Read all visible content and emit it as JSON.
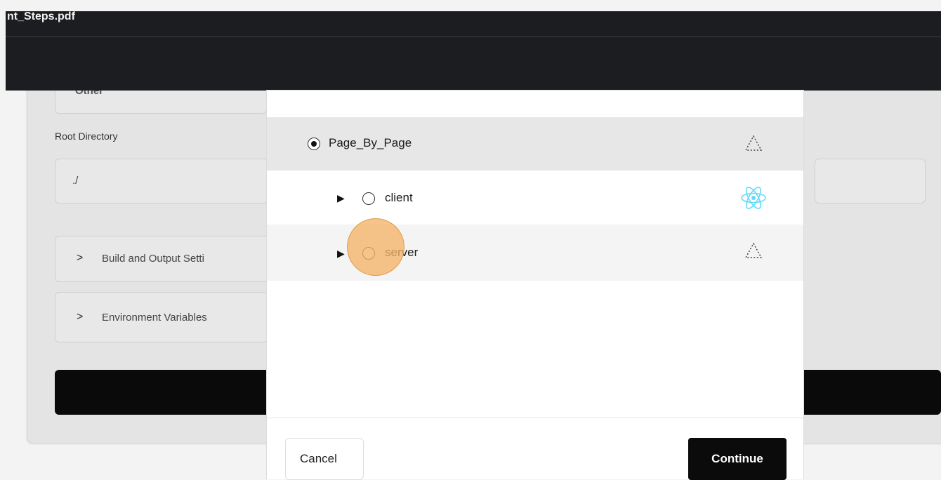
{
  "header": {
    "filename": "nt_Steps.pdf"
  },
  "background_form": {
    "framework_value": "Other",
    "root_directory_label": "Root Directory",
    "root_directory_value": "./",
    "build_section_label": "Build and Output Setti",
    "env_section_label": "Environment Variables"
  },
  "modal": {
    "rows": [
      {
        "label": "Page_By_Page",
        "selected": true,
        "framework_icon": "vercel-triangle-icon"
      },
      {
        "label": "client",
        "selected": false,
        "framework_icon": "react-icon"
      },
      {
        "label": "server",
        "selected": false,
        "framework_icon": "vercel-triangle-icon"
      }
    ],
    "cancel_label": "Cancel",
    "continue_label": "Continue"
  },
  "colors": {
    "accent": "#0b0b0b",
    "react": "#61dafb",
    "click_highlight": "#f3b466"
  }
}
